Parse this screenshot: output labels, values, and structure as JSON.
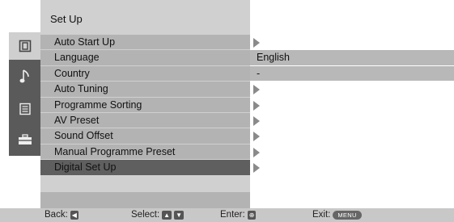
{
  "menu": {
    "title": "Set Up",
    "items": [
      {
        "label": "Auto Start Up",
        "value": "",
        "arrow": true,
        "filled": false,
        "selected": false
      },
      {
        "label": "Language",
        "value": "English",
        "arrow": false,
        "filled": true,
        "selected": false
      },
      {
        "label": "Country",
        "value": "-",
        "arrow": false,
        "filled": true,
        "selected": false
      },
      {
        "label": "Auto Tuning",
        "value": "",
        "arrow": true,
        "filled": false,
        "selected": false
      },
      {
        "label": "Programme Sorting",
        "value": "",
        "arrow": true,
        "filled": false,
        "selected": false
      },
      {
        "label": "AV Preset",
        "value": "",
        "arrow": true,
        "filled": false,
        "selected": false
      },
      {
        "label": "Sound Offset",
        "value": "",
        "arrow": true,
        "filled": false,
        "selected": false
      },
      {
        "label": "Manual Programme Preset",
        "value": "",
        "arrow": true,
        "filled": false,
        "selected": false
      },
      {
        "label": "Digital Set Up",
        "value": "",
        "arrow": true,
        "filled": false,
        "selected": true
      }
    ]
  },
  "sidebar_icons": [
    {
      "name": "picture-icon",
      "active": true
    },
    {
      "name": "sound-note-icon",
      "active": false
    },
    {
      "name": "features-icon",
      "active": false
    },
    {
      "name": "setup-toolbox-icon",
      "active": false
    }
  ],
  "footer": {
    "back_label": "Back:",
    "select_label": "Select:",
    "enter_label": "Enter:",
    "exit_label": "Exit:",
    "menu_key": "MENU"
  },
  "colors": {
    "panel": "#d0d0d0",
    "item_bg": "#b3b3b3",
    "selected_bg": "#5f5f5f",
    "icon_column": "#5a5a5a",
    "footer_bg": "#c8c8c8"
  }
}
